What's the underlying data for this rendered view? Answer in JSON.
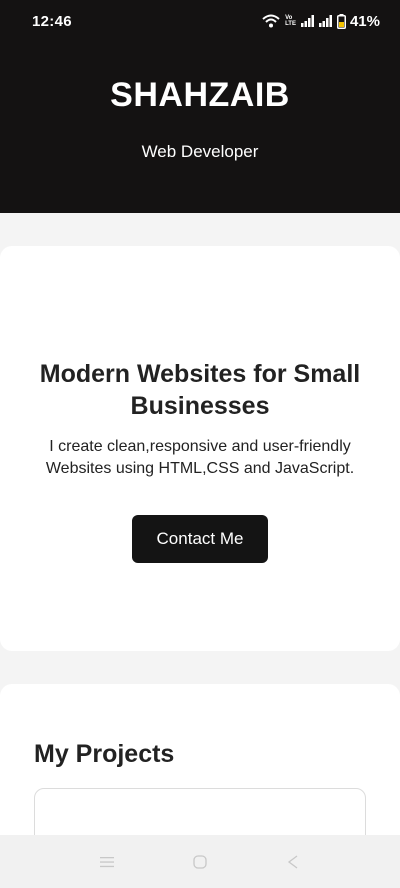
{
  "status_bar": {
    "time": "12:46",
    "lte_top": "Vo",
    "lte_mid": "LTE",
    "battery": "41%",
    "icons": [
      "wifi-icon",
      "volte-icon",
      "signal-icon",
      "signal-icon",
      "battery-icon"
    ]
  },
  "header": {
    "title": "SHAHZAIB",
    "subtitle": "Web Developer"
  },
  "intro": {
    "heading": "Modern Websites for Small Businesses",
    "text": "I create clean,responsive and user-friendly Websites using HTML,CSS and JavaScript.",
    "button_label": "Contact Me"
  },
  "projects": {
    "heading": "My Projects"
  },
  "nav_bar": {
    "icons": [
      "menu-icon",
      "home-icon",
      "back-icon"
    ]
  },
  "colors": {
    "header_bg": "#141212",
    "button_bg": "#141414",
    "page_bg": "#f4f4f4"
  }
}
